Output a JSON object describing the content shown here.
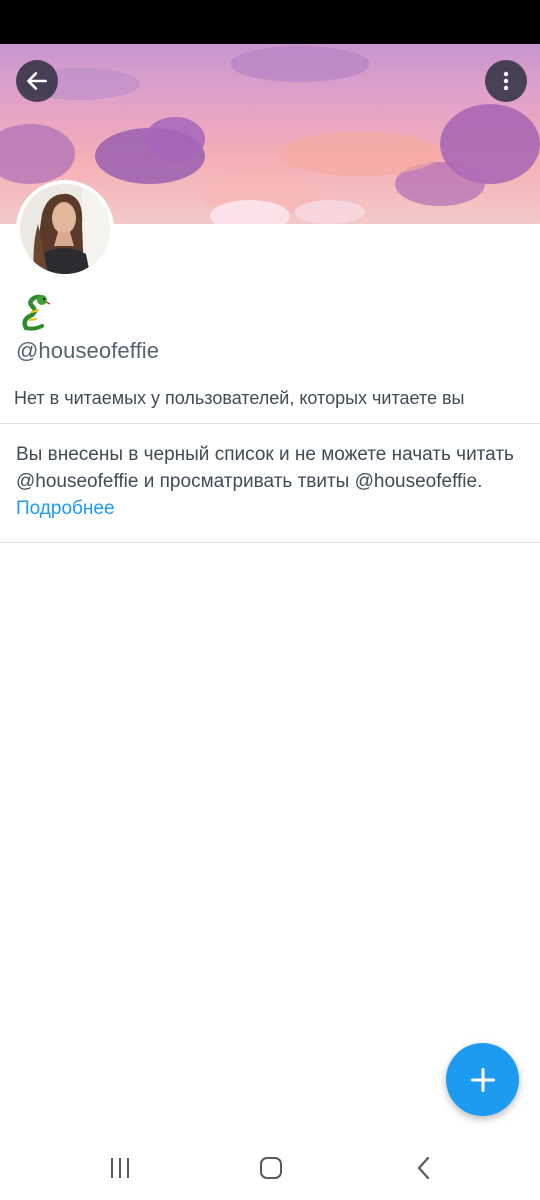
{
  "profile": {
    "handle": "@houseofeffie",
    "display_name_icon": "dragon-emoji",
    "follow_note": "Нет в читаемых у пользователей, которых читаете вы"
  },
  "blocked": {
    "text": "Вы внесены в черный список и не можете начать читать @houseofeffie и просматривать твиты @houseofeffie. ",
    "link_label": "Подробнее"
  },
  "header": {
    "back_icon": "arrow-left-icon",
    "more_icon": "more-vertical-icon"
  },
  "fab": {
    "icon": "plus-icon"
  },
  "system_nav": {
    "recents_icon": "recents-icon",
    "home_icon": "home-icon",
    "back_icon": "back-chevron-icon"
  },
  "colors": {
    "accent": "#1d9bf0",
    "text_secondary": "#536471",
    "text_body": "#414b55",
    "divider": "#dfe3e6"
  }
}
